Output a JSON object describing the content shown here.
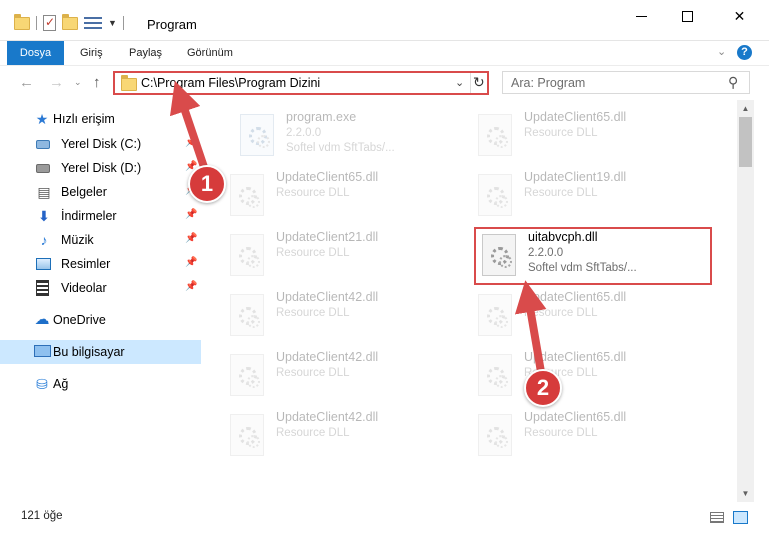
{
  "window": {
    "title": "Program",
    "controls": {
      "minimize": "minimize",
      "maximize": "maximize",
      "close": "✕"
    }
  },
  "ribbon": {
    "tabs": [
      "Dosya",
      "Giriş",
      "Paylaş",
      "Görünüm"
    ],
    "active_tab": "Dosya",
    "accent_color": "#1979ca"
  },
  "navigation": {
    "address": "C:\\Program Files\\Program Dizini",
    "search_placeholder": "Ara: Program"
  },
  "sidebar": {
    "quick_access": {
      "label": "Hızlı erişim",
      "icon": "star-icon"
    },
    "pinned": [
      {
        "label": "Yerel Disk (C:)",
        "icon": "drive-c-icon"
      },
      {
        "label": "Yerel Disk (D:)",
        "icon": "drive-d-icon"
      },
      {
        "label": "Belgeler",
        "icon": "documents-icon"
      },
      {
        "label": "İndirmeler",
        "icon": "downloads-icon"
      },
      {
        "label": "Müzik",
        "icon": "music-icon"
      },
      {
        "label": "Resimler",
        "icon": "pictures-icon"
      },
      {
        "label": "Videolar",
        "icon": "videos-icon"
      }
    ],
    "onedrive": "OneDrive",
    "this_pc": "Bu bilgisayar",
    "network": "Ağ"
  },
  "files": [
    {
      "name": "program.exe",
      "meta1": "2.2.0.0",
      "meta2": "Softel vdm SftTabs/...",
      "faded": true,
      "icon": "exe-icon"
    },
    {
      "name": "UpdateClient65.dll",
      "meta1": "Resource DLL",
      "faded": true,
      "icon": "dll-icon"
    },
    {
      "name": "UpdateClient65.dll",
      "meta1": "Resource DLL",
      "faded": true,
      "icon": "dll-icon"
    },
    {
      "name": "UpdateClient19.dll",
      "meta1": "Resource DLL",
      "faded": true,
      "icon": "dll-icon"
    },
    {
      "name": "UpdateClient21.dll",
      "meta1": "Resource DLL",
      "faded": true,
      "icon": "dll-icon"
    },
    {
      "name": "uitabvcph.dll",
      "meta1": "2.2.0.0",
      "meta2": "Softel vdm SftTabs/...",
      "faded": false,
      "icon": "dll-icon"
    },
    {
      "name": "UpdateClient42.dll",
      "meta1": "Resource DLL",
      "faded": true,
      "icon": "dll-icon"
    },
    {
      "name": "UpdateClient65.dll",
      "meta1": "Resource DLL",
      "faded": true,
      "icon": "dll-icon"
    },
    {
      "name": "UpdateClient42.dll",
      "meta1": "Resource DLL",
      "faded": true,
      "icon": "dll-icon"
    },
    {
      "name": "UpdateClient65.dll",
      "meta1": "Resource DLL",
      "faded": true,
      "icon": "dll-icon"
    },
    {
      "name": "UpdateClient42.dll",
      "meta1": "Resource DLL",
      "faded": true,
      "icon": "dll-icon"
    },
    {
      "name": "UpdateClient65.dll",
      "meta1": "Resource DLL",
      "faded": true,
      "icon": "dll-icon"
    }
  ],
  "status": {
    "item_count": "121 öğe"
  },
  "annotations": {
    "step1": "1",
    "step2": "2",
    "color": "#d94b4b"
  }
}
